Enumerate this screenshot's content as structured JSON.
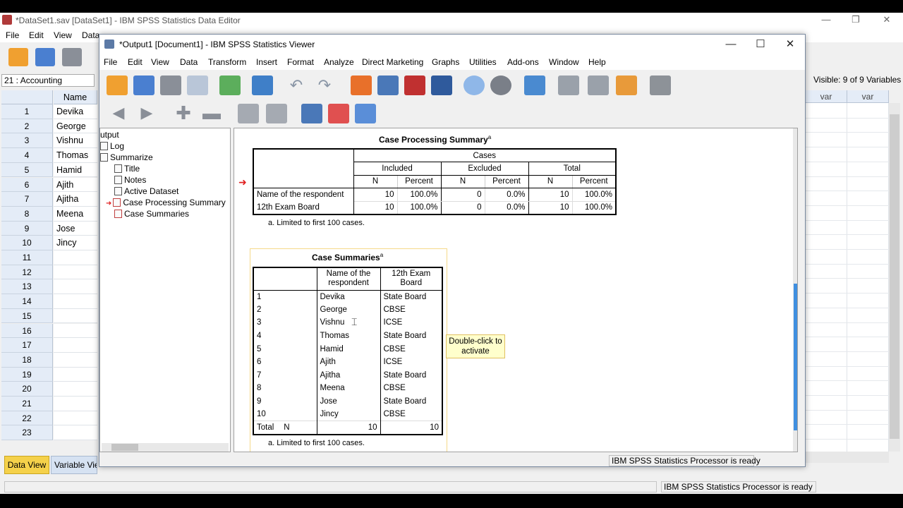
{
  "editor": {
    "title": "*DataSet1.sav [DataSet1] - IBM SPSS Statistics Data Editor",
    "menu": [
      "File",
      "Edit",
      "View",
      "Data"
    ],
    "cell_ref": "21 : Accounting",
    "visible_vars": "Visible: 9 of 9 Variables",
    "column_header": "Name",
    "var_columns": [
      "var",
      "var"
    ],
    "rows": [
      {
        "n": "1",
        "name": "Devika"
      },
      {
        "n": "2",
        "name": "George"
      },
      {
        "n": "3",
        "name": "Vishnu"
      },
      {
        "n": "4",
        "name": "Thomas"
      },
      {
        "n": "5",
        "name": "Hamid"
      },
      {
        "n": "6",
        "name": "Ajith"
      },
      {
        "n": "7",
        "name": "Ajitha"
      },
      {
        "n": "8",
        "name": "Meena"
      },
      {
        "n": "9",
        "name": "Jose"
      },
      {
        "n": "10",
        "name": "Jincy"
      },
      {
        "n": "11",
        "name": ""
      },
      {
        "n": "12",
        "name": ""
      },
      {
        "n": "13",
        "name": ""
      },
      {
        "n": "14",
        "name": ""
      },
      {
        "n": "15",
        "name": ""
      },
      {
        "n": "16",
        "name": ""
      },
      {
        "n": "17",
        "name": ""
      },
      {
        "n": "18",
        "name": ""
      },
      {
        "n": "19",
        "name": ""
      },
      {
        "n": "20",
        "name": ""
      },
      {
        "n": "21",
        "name": ""
      },
      {
        "n": "22",
        "name": ""
      },
      {
        "n": "23",
        "name": ""
      }
    ],
    "tabs": {
      "data_view": "Data View",
      "variable_view": "Variable View"
    },
    "status": "IBM SPSS Statistics Processor is ready"
  },
  "viewer": {
    "title": "*Output1 [Document1] - IBM SPSS Statistics Viewer",
    "menu": [
      "File",
      "Edit",
      "View",
      "Data",
      "Transform",
      "Insert",
      "Format",
      "Analyze",
      "Direct Marketing",
      "Graphs",
      "Utilities",
      "Add-ons",
      "Window",
      "Help"
    ],
    "outline": {
      "root": "utput",
      "log": "Log",
      "summarize": "Summarize",
      "items": [
        "Title",
        "Notes",
        "Active Dataset",
        "Case Processing Summary",
        "Case Summaries"
      ]
    },
    "status": "IBM SPSS Statistics Processor is ready",
    "tooltip": "Double-click to activate"
  },
  "cps": {
    "title": "Case Processing Summary",
    "title_sup": "a",
    "cases": "Cases",
    "groups": [
      "Included",
      "Excluded",
      "Total"
    ],
    "n": "N",
    "percent": "Percent",
    "rows": [
      {
        "label": "Name of the respondent",
        "vals": [
          "10",
          "100.0%",
          "0",
          "0.0%",
          "10",
          "100.0%"
        ]
      },
      {
        "label": "12th Exam Board",
        "vals": [
          "10",
          "100.0%",
          "0",
          "0.0%",
          "10",
          "100.0%"
        ]
      }
    ],
    "note": "a. Limited to first 100 cases."
  },
  "cs": {
    "title": "Case Summaries",
    "title_sup": "a",
    "col1": "Name of the respondent",
    "col2": "12th Exam Board",
    "rows": [
      {
        "n": "1",
        "name": "Devika",
        "board": "State Board"
      },
      {
        "n": "2",
        "name": "George",
        "board": "CBSE"
      },
      {
        "n": "3",
        "name": "Vishnu",
        "board": "ICSE"
      },
      {
        "n": "4",
        "name": "Thomas",
        "board": "State Board"
      },
      {
        "n": "5",
        "name": "Hamid",
        "board": "CBSE"
      },
      {
        "n": "6",
        "name": "Ajith",
        "board": "ICSE"
      },
      {
        "n": "7",
        "name": "Ajitha",
        "board": "State Board"
      },
      {
        "n": "8",
        "name": "Meena",
        "board": "CBSE"
      },
      {
        "n": "9",
        "name": "Jose",
        "board": "State Board"
      },
      {
        "n": "10",
        "name": "Jincy",
        "board": "CBSE"
      }
    ],
    "total_label": "Total",
    "total_n": "N",
    "total_v1": "10",
    "total_v2": "10",
    "note": "a. Limited to first 100 cases."
  },
  "colors": {
    "accent": "#f5d14a",
    "pointer_arrow": "#e02020",
    "tooltip": "#ffffcc"
  }
}
